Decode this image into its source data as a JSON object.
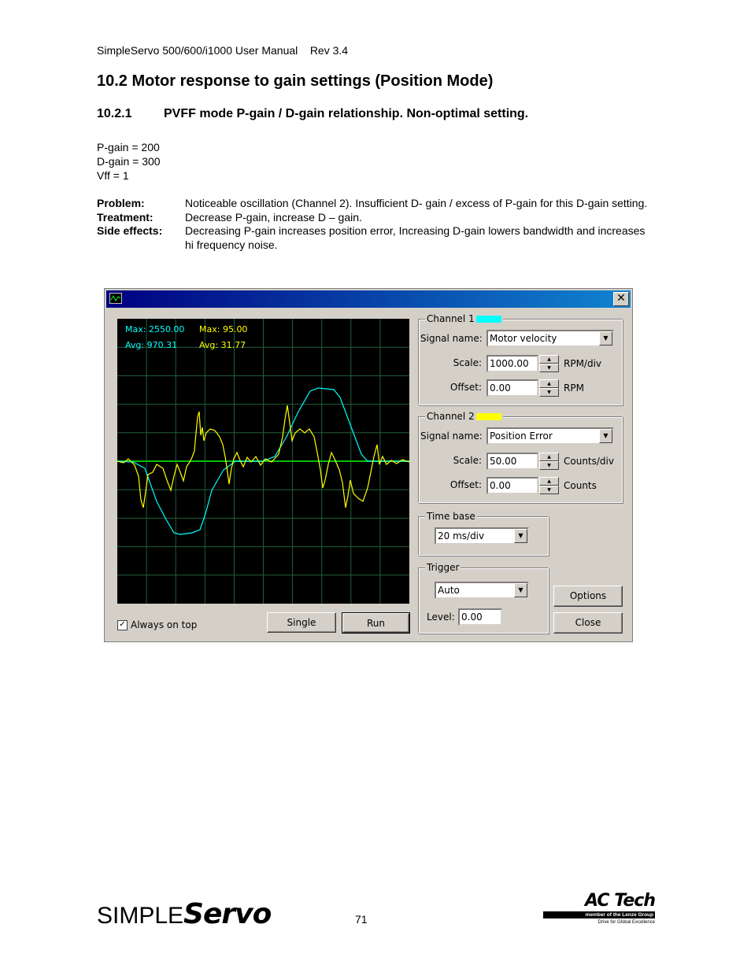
{
  "header": "SimpleServo 500/600/i1000 User Manual    Rev 3.4",
  "section": "10.2 Motor response to gain settings (Position Mode)",
  "subsection": {
    "number": "10.2.1",
    "title": "PVFF mode P-gain / D-gain relationship. Non-optimal setting."
  },
  "params": [
    "P-gain = 200",
    "D-gain = 300",
    "Vff = 1"
  ],
  "notes": [
    {
      "label": "Problem:",
      "text": "Noticeable oscillation (Channel 2).  Insufficient D- gain / excess of P-gain for this D-gain setting."
    },
    {
      "label": "Treatment:",
      "text": "Decrease P-gain, increase D – gain."
    },
    {
      "label": "Side effects:",
      "text": "Decreasing P-gain increases position error, Increasing D-gain lowers bandwidth and increases hi frequency noise."
    }
  ],
  "window": {
    "close_glyph": "✕",
    "app_icon": "scope-icon",
    "readouts": {
      "ch1_max": "Max: 2550.00",
      "ch1_avg": "Avg: 970.31",
      "ch2_max": "Max: 95.00",
      "ch2_avg": "Avg: 31.77"
    },
    "channel1": {
      "title": "Channel 1",
      "color": "#00ffff",
      "signal_label": "Signal name:",
      "signal": "Motor velocity",
      "scale_label": "Scale:",
      "scale": "1000.00",
      "scale_unit": "RPM/div",
      "offset_label": "Offset:",
      "offset": "0.00",
      "offset_unit": "RPM"
    },
    "channel2": {
      "title": "Channel 2",
      "color": "#ffff00",
      "signal_label": "Signal name:",
      "signal": "Position Error",
      "scale_label": "Scale:",
      "scale": "50.00",
      "scale_unit": "Counts/div",
      "offset_label": "Offset:",
      "offset": "0.00",
      "offset_unit": "Counts"
    },
    "timebase": {
      "title": "Time base",
      "value": "20 ms/div"
    },
    "trigger": {
      "title": "Trigger",
      "mode": "Auto",
      "level_label": "Level:",
      "level": "0.00"
    },
    "always_on_top": {
      "label": "Always on top",
      "checked": true,
      "mark": "✓"
    },
    "buttons": {
      "single": "Single",
      "run": "Run",
      "options": "Options",
      "close": "Close"
    }
  },
  "footer": {
    "logo_simple": "SIMPLE",
    "logo_servo": "Servo",
    "page_number": "71",
    "actech_name": "AC Tech",
    "actech_member": "member of the Lenze Group",
    "actech_tagline": "Drive for Global Excellence"
  }
}
